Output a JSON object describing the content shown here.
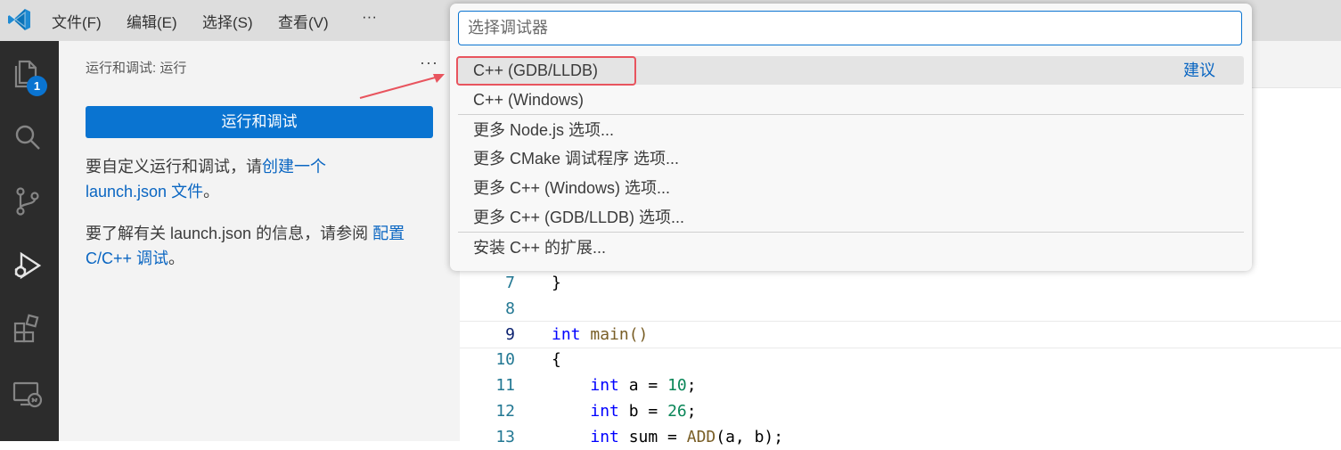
{
  "menu": {
    "file": "文件(F)",
    "edit": "编辑(E)",
    "select": "选择(S)",
    "view": "查看(V)",
    "more": "···"
  },
  "activitybar": {
    "explorer_badge": "1",
    "icons": [
      "files-icon",
      "search-icon",
      "source-control-icon",
      "run-debug-icon",
      "extensions-icon",
      "remote-explorer-icon"
    ]
  },
  "sidebar": {
    "title": "运行和调试: 运行",
    "more": "···",
    "run_button": "运行和调试",
    "para1_prefix": "要自定义运行和调试，请",
    "para1_link": "创建一个",
    "para1_link2": "launch.json 文件",
    "para1_suffix": "。",
    "para2_prefix": "要了解有关 launch.json 的信息，请参阅 ",
    "para2_link": "配置",
    "para2_link2": "C/C++ 调试",
    "para2_suffix": "。"
  },
  "quickpick": {
    "placeholder": "选择调试器",
    "items": [
      {
        "label": "C++ (GDB/LLDB)",
        "detail": "建议"
      },
      {
        "label": "C++ (Windows)"
      },
      {
        "label": "更多 Node.js 选项..."
      },
      {
        "label": "更多 CMake 调试程序 选项..."
      },
      {
        "label": "更多 C++ (Windows) 选项..."
      },
      {
        "label": "更多 C++ (GDB/LLDB) 选项..."
      },
      {
        "label": "安装 C++ 的扩展..."
      }
    ]
  },
  "editor": {
    "lines": [
      {
        "num": "7",
        "text": "}"
      },
      {
        "num": "8",
        "text": ""
      },
      {
        "num": "9",
        "kw": "int",
        "rest": " main()"
      },
      {
        "num": "10",
        "text": "{"
      },
      {
        "num": "11",
        "kw": "int",
        "var": " a = ",
        "val": "10",
        "end": ";"
      },
      {
        "num": "12",
        "kw": "int",
        "var": " b = ",
        "val": "26",
        "end": ";"
      },
      {
        "num": "13",
        "kw": "int",
        "var": " sum = ",
        "call": "ADD",
        "args": "(a, b);"
      }
    ]
  },
  "colors": {
    "accent": "#0a74d1",
    "annotation": "#e8545e",
    "activitybar": "#2c2c2c"
  }
}
